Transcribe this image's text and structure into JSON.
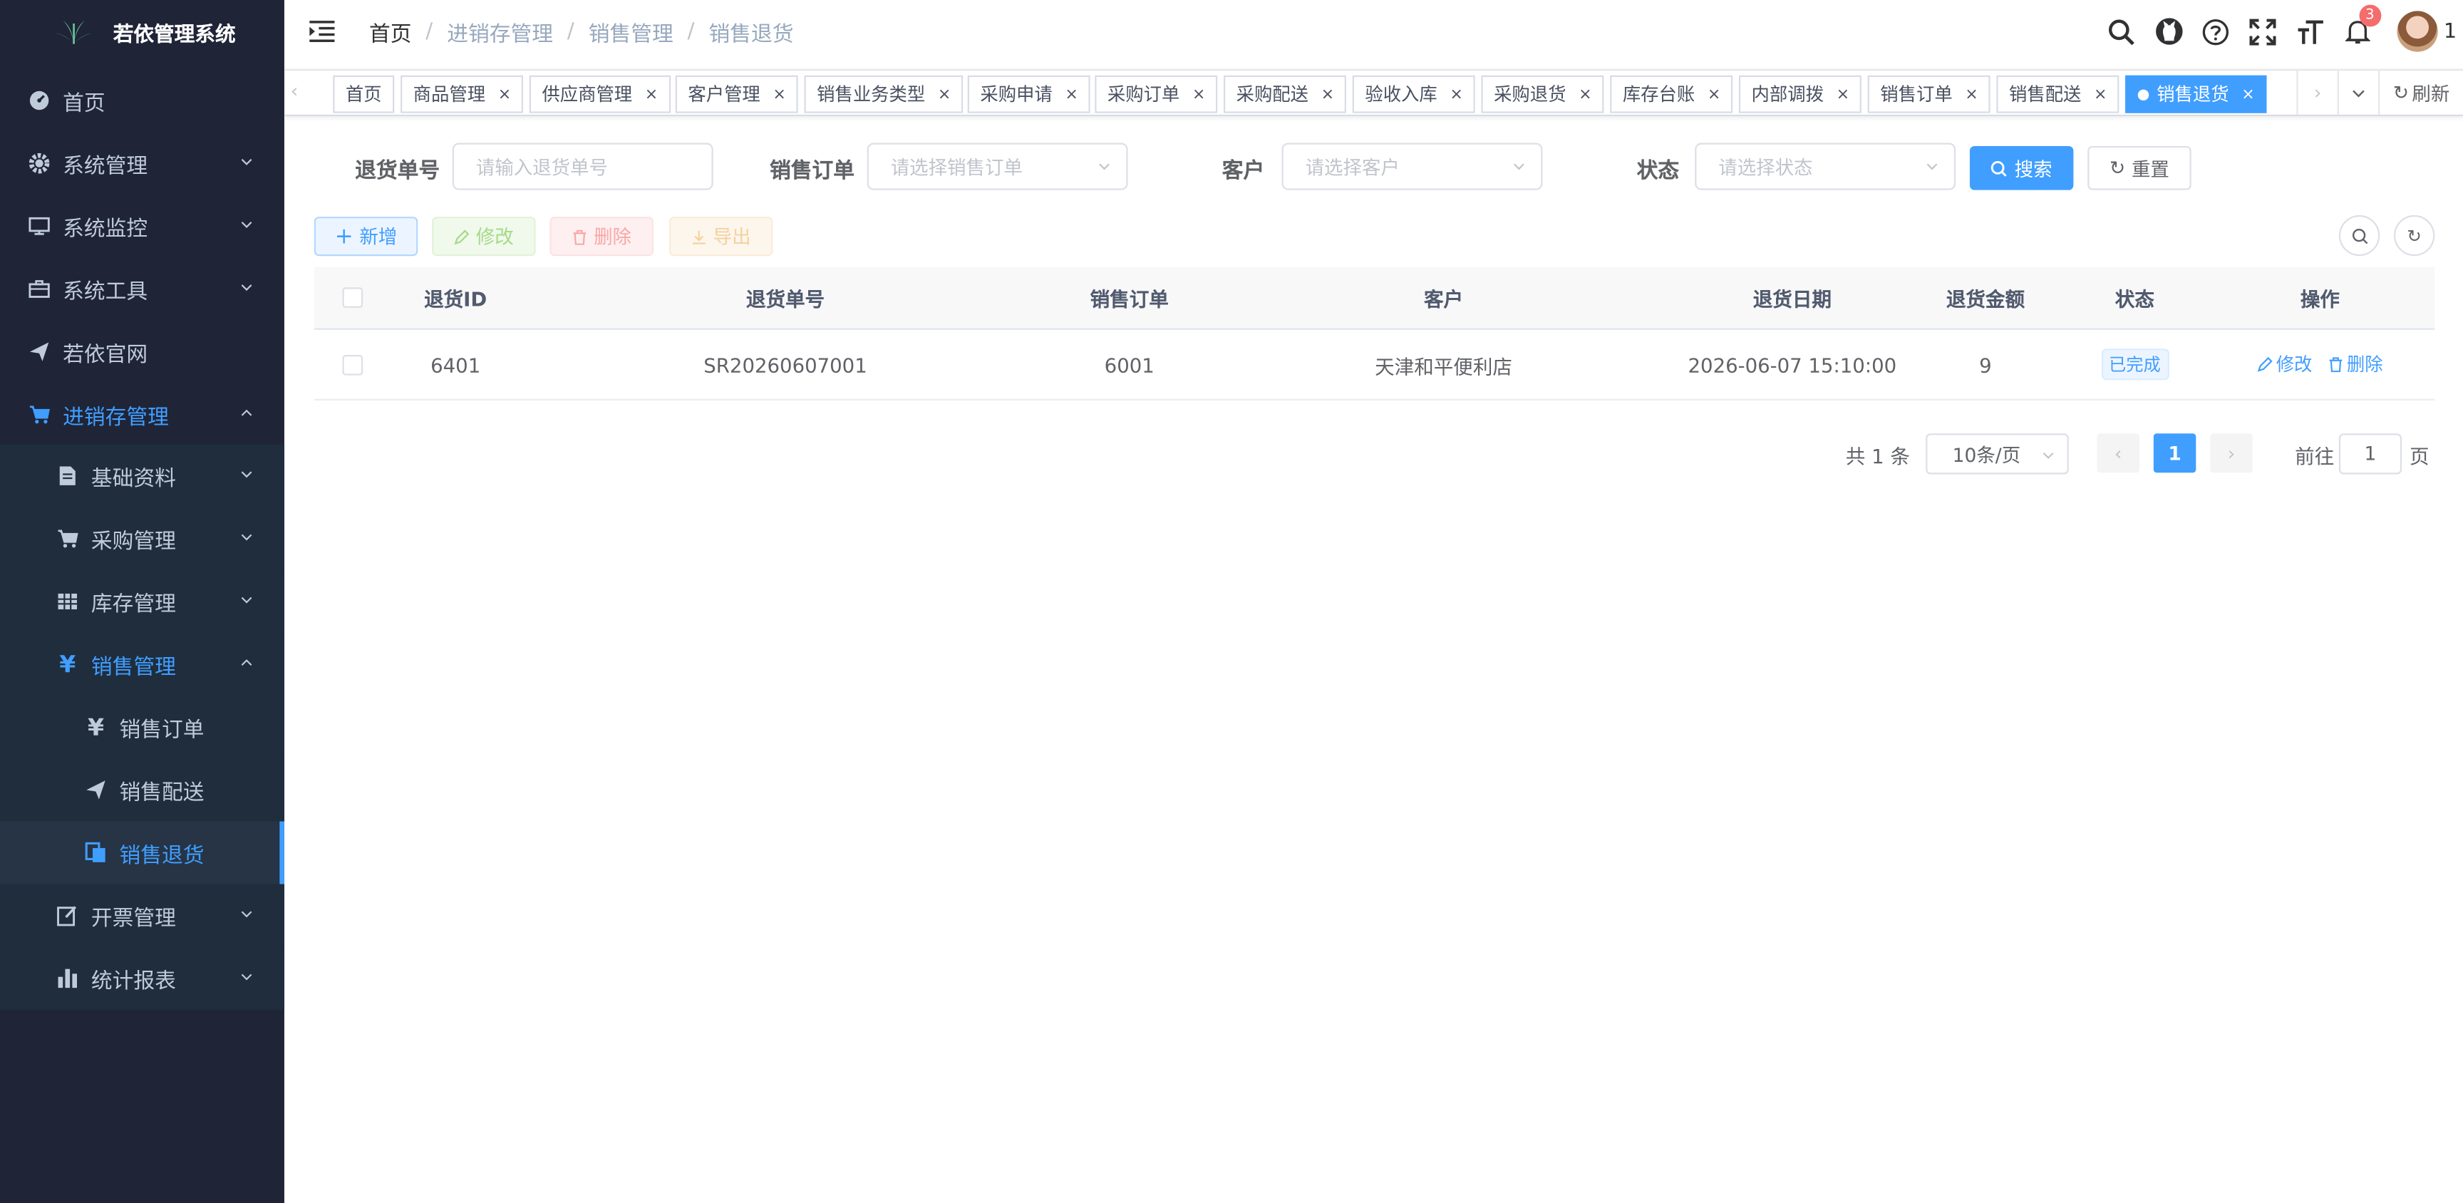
{
  "app": {
    "title": "若依管理系统"
  },
  "sidebar": {
    "items": [
      {
        "label": "首页",
        "icon": "dashboard-icon"
      },
      {
        "label": "系统管理",
        "icon": "gear-icon"
      },
      {
        "label": "系统监控",
        "icon": "monitor-icon"
      },
      {
        "label": "系统工具",
        "icon": "toolbox-icon"
      },
      {
        "label": "若依官网",
        "icon": "paper-plane-icon"
      },
      {
        "label": "进销存管理",
        "icon": "cart-icon"
      },
      {
        "label": "基础资料",
        "icon": "document-icon"
      },
      {
        "label": "采购管理",
        "icon": "cart-icon"
      },
      {
        "label": "库存管理",
        "icon": "grid-icon"
      },
      {
        "label": "销售管理",
        "icon": "yen-icon"
      },
      {
        "label": "销售订单",
        "icon": "yen-icon"
      },
      {
        "label": "销售配送",
        "icon": "paper-plane-icon"
      },
      {
        "label": "销售退货",
        "icon": "return-icon"
      },
      {
        "label": "开票管理",
        "icon": "edit-icon"
      },
      {
        "label": "统计报表",
        "icon": "bar-chart-icon"
      }
    ]
  },
  "breadcrumb": [
    "首页",
    "进销存管理",
    "销售管理",
    "销售退货"
  ],
  "navbar": {
    "notification_count": "3",
    "user": "1"
  },
  "tags": [
    "首页",
    "商品管理",
    "供应商管理",
    "客户管理",
    "销售业务类型",
    "采购申请",
    "采购订单",
    "采购配送",
    "验收入库",
    "采购退货",
    "库存台账",
    "内部调拨",
    "销售订单",
    "销售配送",
    "销售退货"
  ],
  "tags_refresh": "刷新",
  "search": {
    "return_no_label": "退货单号",
    "return_no_placeholder": "请输入退货单号",
    "order_label": "销售订单",
    "order_placeholder": "请选择销售订单",
    "customer_label": "客户",
    "customer_placeholder": "请选择客户",
    "status_label": "状态",
    "status_placeholder": "请选择状态",
    "search_btn": "搜索",
    "reset_btn": "重置"
  },
  "toolbar": {
    "add": "新增",
    "edit": "修改",
    "delete": "删除",
    "export": "导出"
  },
  "table": {
    "headers": [
      "退货ID",
      "退货单号",
      "销售订单",
      "客户",
      "退货日期",
      "退货金额",
      "状态",
      "操作"
    ],
    "rows": [
      {
        "id": "6401",
        "return_no": "SR20260607001",
        "order": "6001",
        "customer": "天津和平便利店",
        "date": "2026-06-07 15:10:00",
        "amount": "9",
        "status": "已完成",
        "edit": "修改",
        "delete": "删除"
      }
    ]
  },
  "pagination": {
    "total": "共 1 条",
    "page_size": "10条/页",
    "current": "1",
    "goto_label": "前往",
    "goto_value": "1",
    "page_unit": "页"
  },
  "colors": {
    "primary": "#409eff",
    "sidebar_bg": "#1f2437",
    "badge": "#f56c6c"
  }
}
